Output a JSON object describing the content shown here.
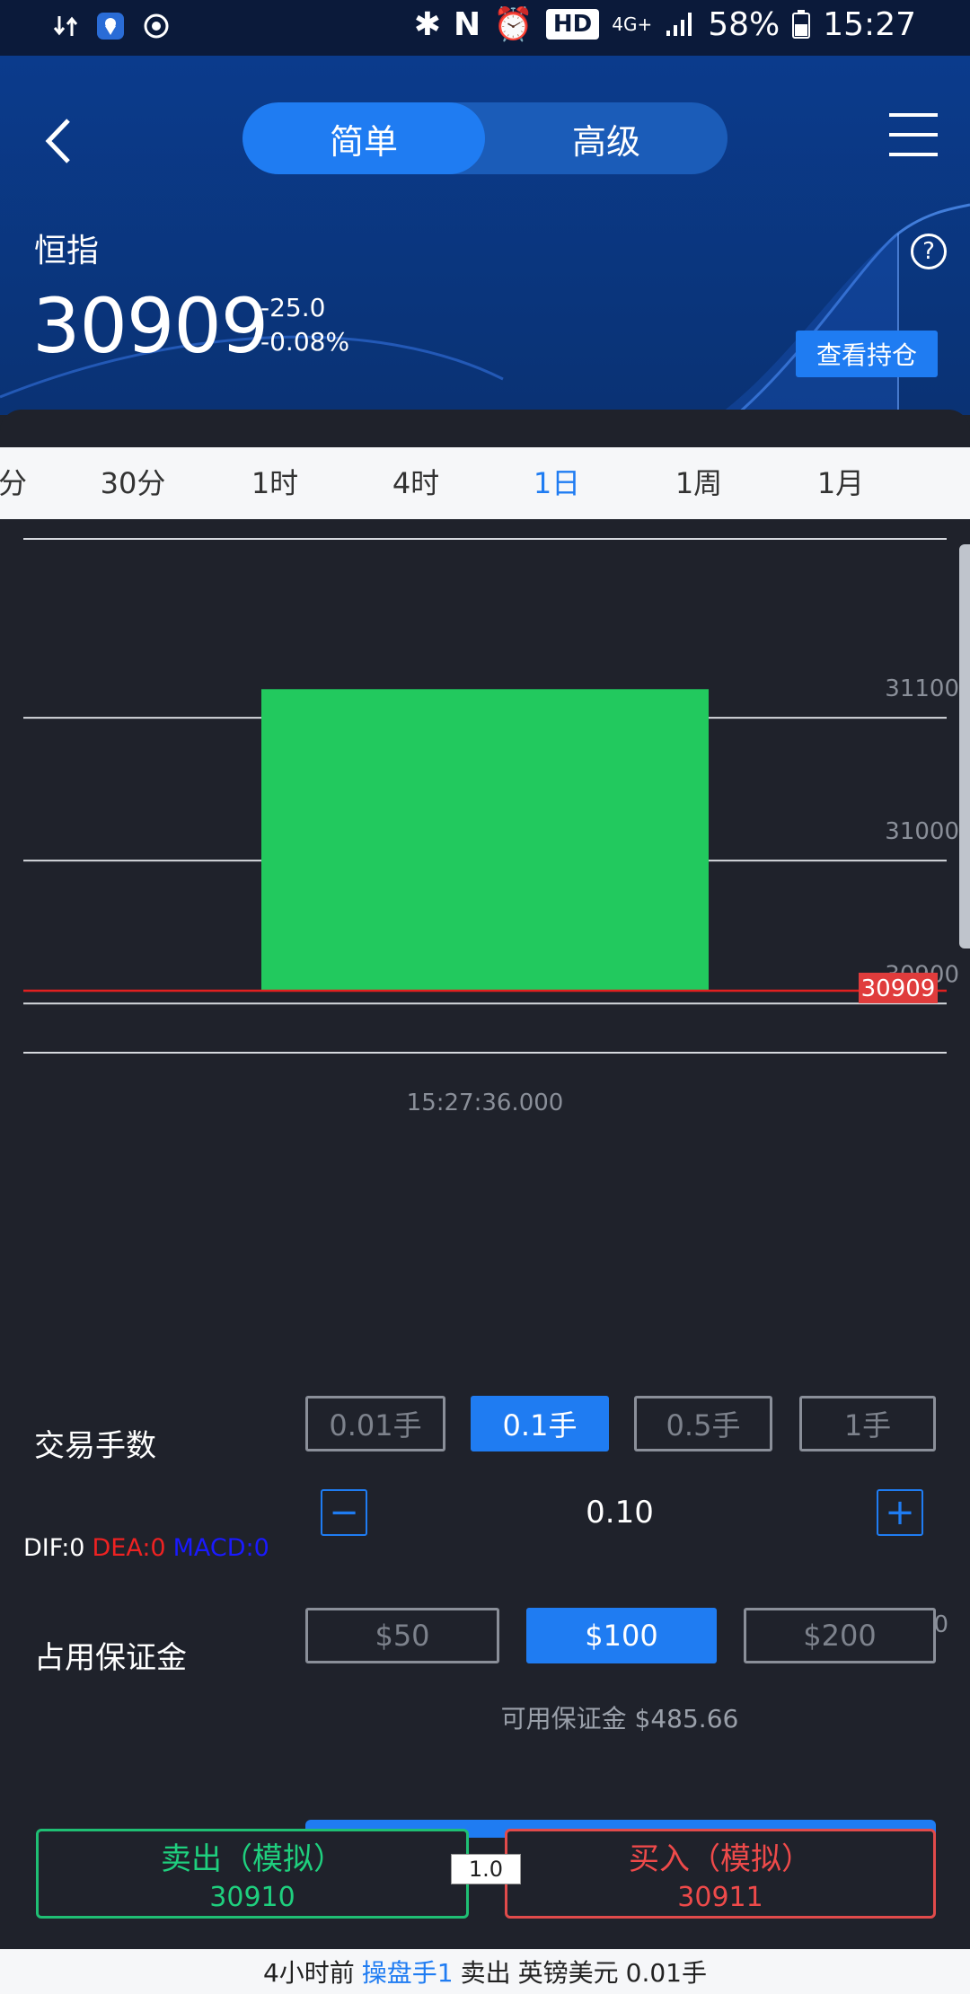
{
  "status_bar": {
    "battery": "58%",
    "time": "15:27",
    "hd": "HD",
    "network": "4G+"
  },
  "header": {
    "tabs": [
      "简单",
      "高级"
    ],
    "active_tab": "简单",
    "symbol": "恒指",
    "price": "30909",
    "change": "-25.0",
    "change_pct": "-0.08%",
    "help": "?",
    "positions_button": "查看持仓"
  },
  "timeframes": [
    "分",
    "30分",
    "1时",
    "4时",
    "1日",
    "1周",
    "1月"
  ],
  "active_timeframe": "1日",
  "chart_data": {
    "type": "bar",
    "series_type": "candlestick",
    "x": [
      "15:27:36.000"
    ],
    "candles": [
      {
        "open": 31120,
        "close": 30909
      }
    ],
    "y_ticks": [
      31100,
      31000,
      30900
    ],
    "current_price_label": "30909",
    "ylim": [
      30892,
      31200
    ],
    "up_color": "#ee4a4a",
    "down_color": "#22c95e"
  },
  "macd": {
    "dif": "DIF:0",
    "dea": "DEA:0",
    "macd": "MACD:0",
    "zero_label": "0"
  },
  "trade": {
    "lot_label": "交易手数",
    "lot_options": [
      "0.01手",
      "0.1手",
      "0.5手",
      "1手"
    ],
    "lot_selected": "0.1手",
    "minus": "−",
    "plus": "+",
    "quantity": "0.10",
    "margin_label": "占用保证金",
    "margin_options": [
      "$50",
      "$100",
      "$200"
    ],
    "margin_selected": "$100",
    "available_margin": "可用保证金 $485.66",
    "sell_label": "卖出（模拟）",
    "sell_price": "30910",
    "buy_label": "买入（模拟）",
    "buy_price": "30911",
    "spread": "1.0"
  },
  "ticker": {
    "time_ago": "4小时前",
    "user": "操盘手1",
    "action": "卖出",
    "instrument": "英镑美元",
    "amount": "0.01手"
  },
  "colors": {
    "accent": "#1f7cf2",
    "sell": "#1fcf7e",
    "buy": "#ee4a4a",
    "header_bg": "#0b3b8c",
    "panel_bg": "#1f222b"
  }
}
